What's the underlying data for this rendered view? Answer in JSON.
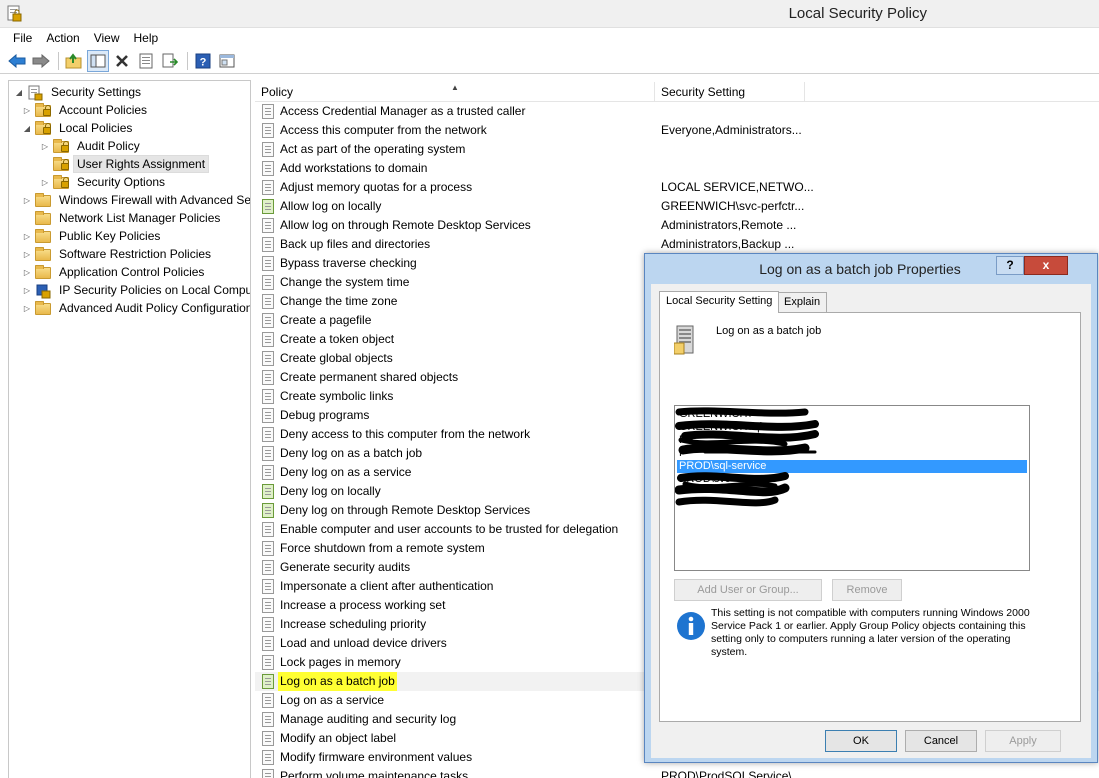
{
  "window": {
    "title": "Local Security Policy"
  },
  "menu": [
    "File",
    "Action",
    "View",
    "Help"
  ],
  "toolbar": {
    "icons": [
      "back-arrow-icon",
      "forward-arrow-icon",
      "up-folder-icon",
      "show-hide-tree-icon",
      "delete-icon",
      "properties-icon",
      "export-list-icon",
      "help-icon",
      "console-tree-icon"
    ]
  },
  "tree": {
    "items": [
      {
        "label": "Security Settings",
        "level": 0,
        "expander": "open",
        "icon": "root"
      },
      {
        "label": "Account Policies",
        "level": 1,
        "expander": "closed",
        "icon": "folder-lock"
      },
      {
        "label": "Local Policies",
        "level": 1,
        "expander": "open",
        "icon": "folder-lock"
      },
      {
        "label": "Audit Policy",
        "level": 2,
        "expander": "closed",
        "icon": "folder-lock"
      },
      {
        "label": "User Rights Assignment",
        "level": 2,
        "expander": "none",
        "icon": "folder-lock",
        "selected": true
      },
      {
        "label": "Security Options",
        "level": 2,
        "expander": "closed",
        "icon": "folder-lock"
      },
      {
        "label": "Windows Firewall with Advanced Security",
        "level": 1,
        "expander": "closed",
        "icon": "folder"
      },
      {
        "label": "Network List Manager Policies",
        "level": 1,
        "expander": "none",
        "icon": "folder"
      },
      {
        "label": "Public Key Policies",
        "level": 1,
        "expander": "closed",
        "icon": "folder"
      },
      {
        "label": "Software Restriction Policies",
        "level": 1,
        "expander": "closed",
        "icon": "folder"
      },
      {
        "label": "Application Control Policies",
        "level": 1,
        "expander": "closed",
        "icon": "folder"
      },
      {
        "label": "IP Security Policies on Local Computer",
        "level": 1,
        "expander": "closed",
        "icon": "ipsec"
      },
      {
        "label": "Advanced Audit Policy Configuration",
        "level": 1,
        "expander": "closed",
        "icon": "folder"
      }
    ]
  },
  "list": {
    "columns": [
      "Policy",
      "Security Setting"
    ],
    "rows": [
      {
        "policy": "Access Credential Manager as a trusted caller",
        "setting": ""
      },
      {
        "policy": "Access this computer from the network",
        "setting": "Everyone,Administrators..."
      },
      {
        "policy": "Act as part of the operating system",
        "setting": ""
      },
      {
        "policy": "Add workstations to domain",
        "setting": ""
      },
      {
        "policy": "Adjust memory quotas for a process",
        "setting": "LOCAL SERVICE,NETWO..."
      },
      {
        "policy": "Allow log on locally",
        "setting": "GREENWICH\\svc-perfctr...",
        "green": true
      },
      {
        "policy": "Allow log on through Remote Desktop Services",
        "setting": "Administrators,Remote ..."
      },
      {
        "policy": "Back up files and directories",
        "setting": "Administrators,Backup ..."
      },
      {
        "policy": "Bypass traverse checking",
        "setting": ""
      },
      {
        "policy": "Change the system time",
        "setting": ""
      },
      {
        "policy": "Change the time zone",
        "setting": ""
      },
      {
        "policy": "Create a pagefile",
        "setting": ""
      },
      {
        "policy": "Create a token object",
        "setting": ""
      },
      {
        "policy": "Create global objects",
        "setting": ""
      },
      {
        "policy": "Create permanent shared objects",
        "setting": ""
      },
      {
        "policy": "Create symbolic links",
        "setting": ""
      },
      {
        "policy": "Debug programs",
        "setting": ""
      },
      {
        "policy": "Deny access to this computer from the network",
        "setting": ""
      },
      {
        "policy": "Deny log on as a batch job",
        "setting": ""
      },
      {
        "policy": "Deny log on as a service",
        "setting": ""
      },
      {
        "policy": "Deny log on locally",
        "setting": "",
        "green": true
      },
      {
        "policy": "Deny log on through Remote Desktop Services",
        "setting": "",
        "green": true
      },
      {
        "policy": "Enable computer and user accounts to be trusted for delegation",
        "setting": ""
      },
      {
        "policy": "Force shutdown from a remote system",
        "setting": ""
      },
      {
        "policy": "Generate security audits",
        "setting": ""
      },
      {
        "policy": "Impersonate a client after authentication",
        "setting": ""
      },
      {
        "policy": "Increase a process working set",
        "setting": ""
      },
      {
        "policy": "Increase scheduling priority",
        "setting": ""
      },
      {
        "policy": "Load and unload device drivers",
        "setting": ""
      },
      {
        "policy": "Lock pages in memory",
        "setting": ""
      },
      {
        "policy": "Log on as a batch job",
        "setting": "",
        "green": true,
        "highlighted": true
      },
      {
        "policy": "Log on as a service",
        "setting": ""
      },
      {
        "policy": "Manage auditing and security log",
        "setting": ""
      },
      {
        "policy": "Modify an object label",
        "setting": ""
      },
      {
        "policy": "Modify firmware environment values",
        "setting": ""
      },
      {
        "policy": "Perform volume maintenance tasks",
        "setting": "PROD\\ProdSQLService\\"
      }
    ]
  },
  "dialog": {
    "title": "Log on as a batch job Properties",
    "help_label": "?",
    "close_label": "x",
    "tabs": [
      "Local Security Setting",
      "Explain"
    ],
    "policy_name": "Log on as a batch job",
    "members": [
      {
        "text": "GREENWICH\\",
        "selected": false
      },
      {
        "text": "GREENWICH\\                    ql",
        "selected": false
      },
      {
        "text": "PR",
        "selected": false
      },
      {
        "text": "P",
        "selected": false
      },
      {
        "text": "PROD\\sql-service",
        "selected": true
      },
      {
        "text": "PROD\\svc-",
        "selected": false
      },
      {
        "text": "",
        "selected": false
      },
      {
        "text": "",
        "selected": false
      }
    ],
    "add_button": "Add User or Group...",
    "remove_button": "Remove",
    "info_text": "This setting is not compatible with computers running Windows 2000 Service Pack 1 or earlier.  Apply Group Policy objects containing this setting only to computers running a later version of the operating system.",
    "ok": "OK",
    "cancel": "Cancel",
    "apply": "Apply"
  },
  "colors": {
    "selection": "#3399ff",
    "highlight": "#ffff33",
    "close_red": "#c74b3b",
    "dialog_frame": "#bcd6f0"
  }
}
